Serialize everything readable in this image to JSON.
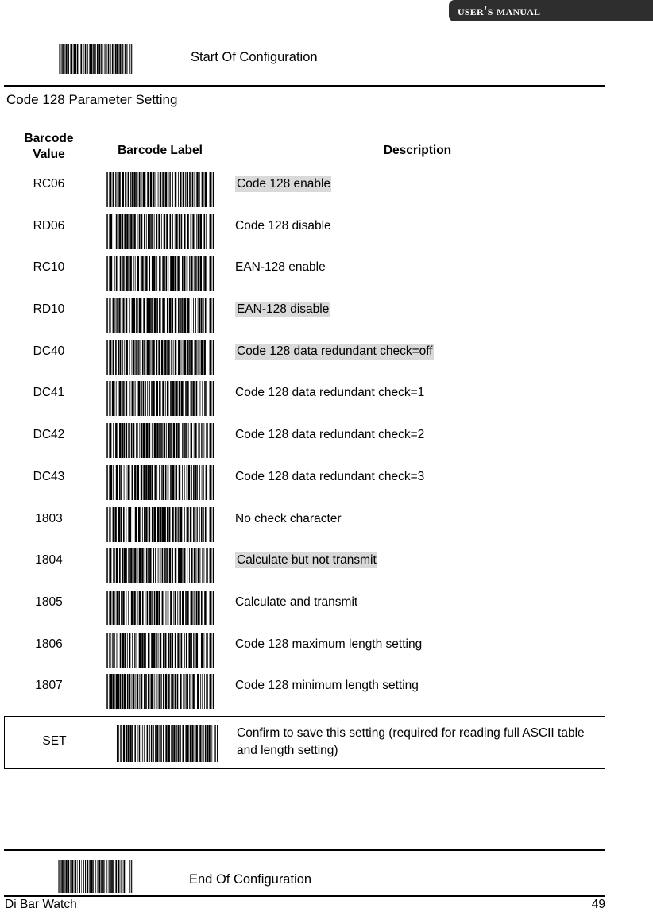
{
  "header": {
    "title": "User's Manual"
  },
  "start_config": {
    "label": "Start Of Configuration",
    "barcode_name": "start-of-configuration-barcode"
  },
  "end_config": {
    "label": "End Of Configuration",
    "barcode_name": "end-of-configuration-barcode"
  },
  "section": {
    "title": "Code 128 Parameter Setting"
  },
  "table": {
    "headers": {
      "value_line1": "Barcode",
      "value_line2": "Value",
      "label": "Barcode Label",
      "description": "Description"
    },
    "rows": [
      {
        "value": "RC06",
        "description": "Code 128 enable",
        "highlight": true
      },
      {
        "value": "RD06",
        "description": "Code 128 disable",
        "highlight": false
      },
      {
        "value": "RC10",
        "description": "EAN-128 enable",
        "highlight": false
      },
      {
        "value": "RD10",
        "description": "EAN-128 disable",
        "highlight": true
      },
      {
        "value": "DC40",
        "description": "Code 128 data redundant check=off",
        "highlight": true
      },
      {
        "value": "DC41",
        "description": "Code 128 data redundant check=1",
        "highlight": false
      },
      {
        "value": "DC42",
        "description": "Code 128 data redundant check=2",
        "highlight": false
      },
      {
        "value": "DC43",
        "description": "Code 128 data redundant check=3",
        "highlight": false
      },
      {
        "value": "1803",
        "description": "No check character",
        "highlight": false
      },
      {
        "value": "1804",
        "description": "Calculate but not transmit",
        "highlight": true
      },
      {
        "value": "1805",
        "description": "Calculate and transmit",
        "highlight": false
      },
      {
        "value": "1806",
        "description": "Code 128 maximum length setting",
        "highlight": false
      },
      {
        "value": "1807",
        "description": "Code 128 minimum length setting",
        "highlight": false
      }
    ]
  },
  "set_box": {
    "value": "SET",
    "description": "Confirm to save this setting (required for reading full ASCII table and length setting)"
  },
  "footer": {
    "brand": "Di Bar Watch",
    "page": "49"
  },
  "colors": {
    "header_bar": "#2e2e2e",
    "highlight": "#d9d9d9",
    "rule": "#000000"
  }
}
